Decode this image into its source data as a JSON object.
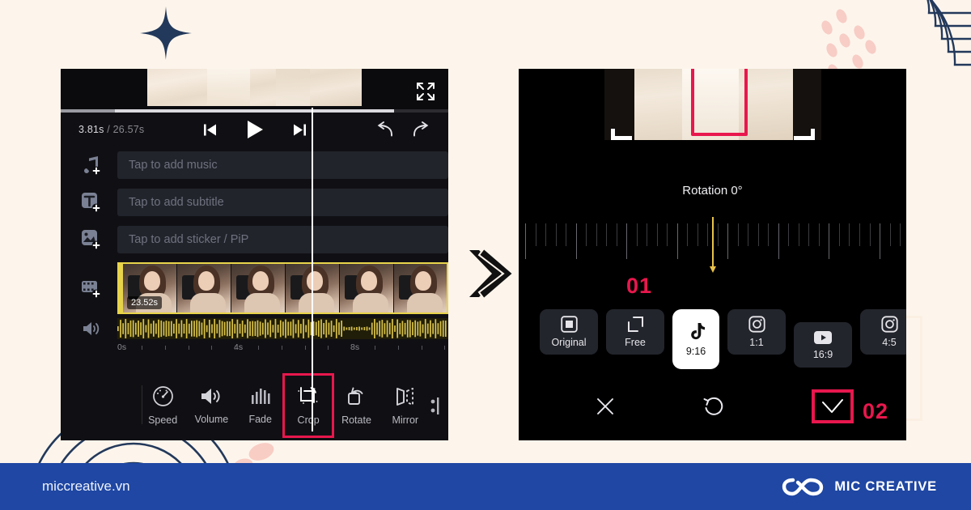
{
  "page": {
    "background_color": "#FDF5EC",
    "accent_pink": "#E8174D",
    "footer_blue": "#1F47A3",
    "navy": "#23395B"
  },
  "arrow": {
    "icon": "double-chevron-right-arrow"
  },
  "left_panel": {
    "name": "video-editor-timeline-screen",
    "fullscreen_icon": "fullscreen-expand-icon",
    "time": {
      "current": "3.81s",
      "separator": "/",
      "total": "26.57s"
    },
    "transport": {
      "previous": "skip-previous-icon",
      "play": "play-icon",
      "next": "skip-next-icon"
    },
    "history": {
      "undo": "undo-icon",
      "redo": "redo-icon"
    },
    "tracks": [
      {
        "icon": "add-music-icon",
        "placeholder": "Tap to add music"
      },
      {
        "icon": "add-subtitle-icon",
        "placeholder": "Tap to add subtitle"
      },
      {
        "icon": "add-sticker-icon",
        "placeholder": "Tap to add sticker / PiP"
      }
    ],
    "clip": {
      "icon": "add-video-icon",
      "duration": "23.52s"
    },
    "audio": {
      "icon": "volume-icon"
    },
    "ruler": {
      "labels": [
        "0s",
        "4s",
        "8s"
      ]
    },
    "toolbar": [
      {
        "label": "Speed",
        "icon": "speedometer-icon",
        "selected": false
      },
      {
        "label": "Volume",
        "icon": "volume-wave-icon",
        "selected": false
      },
      {
        "label": "Fade",
        "icon": "fade-bars-icon",
        "selected": false
      },
      {
        "label": "Crop",
        "icon": "crop-icon",
        "selected": true
      },
      {
        "label": "Rotate",
        "icon": "rotate-icon",
        "selected": false
      },
      {
        "label": "Mirror",
        "icon": "mirror-icon",
        "selected": false
      }
    ]
  },
  "right_panel": {
    "name": "crop-and-rotate-screen",
    "crop_handles": "crop-corner-handles",
    "rotation_label": "Rotation 0°",
    "rotation_value": 0,
    "aspect_ratios": [
      {
        "label": "Original",
        "icon": "square-outline-icon",
        "selected": false
      },
      {
        "label": "Free",
        "icon": "free-resize-icon",
        "selected": false
      },
      {
        "label": "9:16",
        "icon": "tiktok-icon",
        "selected": true
      },
      {
        "label": "1:1",
        "icon": "instagram-icon",
        "selected": false
      },
      {
        "label": "16:9",
        "icon": "youtube-icon",
        "selected": false
      },
      {
        "label": "4:5",
        "icon": "instagram-icon",
        "selected": false
      }
    ],
    "actions": {
      "cancel": "close-x-icon",
      "reset": "reset-rotate-icon",
      "confirm": "checkmark-icon"
    }
  },
  "annotations": {
    "step_one": "01",
    "step_two": "02"
  },
  "footer": {
    "url": "miccreative.vn",
    "brand_name": "MIC CREATIVE",
    "brand_logo": "infinity-loop-logo"
  }
}
